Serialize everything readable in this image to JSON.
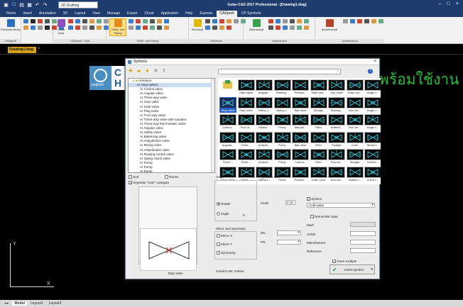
{
  "app": {
    "title": "Gstar-CAD 2017 Professional - [Drawing1.dwg]",
    "workspace": "2D Drafting"
  },
  "tabs": [
    "Home",
    "Insert",
    "Annotation",
    "3D",
    "Layout",
    "View",
    "Manage",
    "Export",
    "Cloud",
    "Application",
    "Help",
    "Express",
    "CADprofi",
    "CP-Symbols"
  ],
  "active_tab": "CADprofi",
  "ribbon": {
    "products": "Products library",
    "groups": [
      "CADprofi",
      "CADprofi - Edit",
      "HVAC and Piping",
      "Electrical",
      "Mechanical",
      "Architectural"
    ],
    "buttons": [
      "Guide tools",
      "HVAC and Piping",
      "Electrical",
      "Mechanical",
      "Architectural"
    ]
  },
  "document": {
    "tab": "Drawing1.dwg",
    "close": "×"
  },
  "canvas": {
    "logo_small": "cadprofi",
    "logo_big": "C\nH",
    "thai_text": "พร้อมใช้งาน",
    "ucs_y": "Y",
    "ucs_x": "X"
  },
  "layout_tabs": [
    "Model",
    "Layout1",
    "Layout2"
  ],
  "dialog": {
    "title": "Symbols",
    "close": "×",
    "tree": [
      "Armature",
      "Stop valves",
      "Control valve",
      "Angular valve",
      "Three-way valve",
      "Stop valve",
      "Gate valve",
      "Plug valve",
      "Four-way valve",
      "Three-way valve with actuator",
      "Three-way thermostatic valve",
      "Angular valve",
      "Safety valve",
      "Balancing valve",
      "Antipollution valve",
      "Mixing valve",
      "Antipollution valve",
      "Routing control valve",
      "Swing check valve",
      "Pump",
      "Pump",
      "Pump",
      "Pressure reducing valve"
    ],
    "grid": [
      [
        "",
        "Gate valve",
        "Angular...",
        "Routing...",
        "Pressur...",
        "Stain valv...",
        "Cap valve",
        "Drain val...",
        "Angle v..."
      ],
      [
        "Stop valve",
        "Stop valve",
        "Safety v...",
        "Swing c...",
        "Ball valve",
        "Sludger",
        "Sluicing...",
        "Non-ret...",
        "Angle v..."
      ],
      [
        "Control...",
        "Four-w...",
        "Balanc...",
        "Pump",
        "Manual...",
        "Filter",
        "Butterfl...",
        "Non-ret...",
        "Angle v..."
      ],
      [
        "Angular...",
        "Three-...",
        "Antipoll...",
        "Pump",
        "Ball valve",
        "Filter",
        "Sludger",
        "Cock",
        "Steam t..."
      ],
      [
        "Three-...",
        "Three-...",
        "Antipoll...",
        "Pump",
        "Control...",
        "Filter",
        "Non-ret...",
        "Sludger",
        "Overflo..."
      ],
      [
        "Stop valve",
        "Three-...",
        "Safety v...",
        "Pump",
        "Pressur...",
        "Drain cock",
        "Non-ret...",
        "Safety v...",
        "3-line v..."
      ]
    ],
    "sort": "Sort",
    "norms": "Norms",
    "separate": "Separate \"User\" category",
    "preview_caption": "Stop valve",
    "angle": "Angle",
    "rotate": "Rotate",
    "angle_opt": "Angle",
    "angle_val": "0",
    "mirror": "Mirror and Symmetry",
    "mirror_x": "Mirror X",
    "mirror_y": "Mirror Y",
    "symmetry": "Symmetry",
    "units": "Current unit: metres",
    "symsize": "Symbols size",
    "scale": "Scale",
    "scale_val": "0.15",
    "dn": "DN",
    "pn": "PN",
    "system": "System",
    "system_val": "Cold water",
    "remember": "Remember data",
    "mark": "Mark",
    "article": "Article",
    "manufacturer": "Manufacturer",
    "reference": "Reference",
    "insert_multiple": "Insert multiple",
    "insert_symbol": "Insert symbol"
  }
}
